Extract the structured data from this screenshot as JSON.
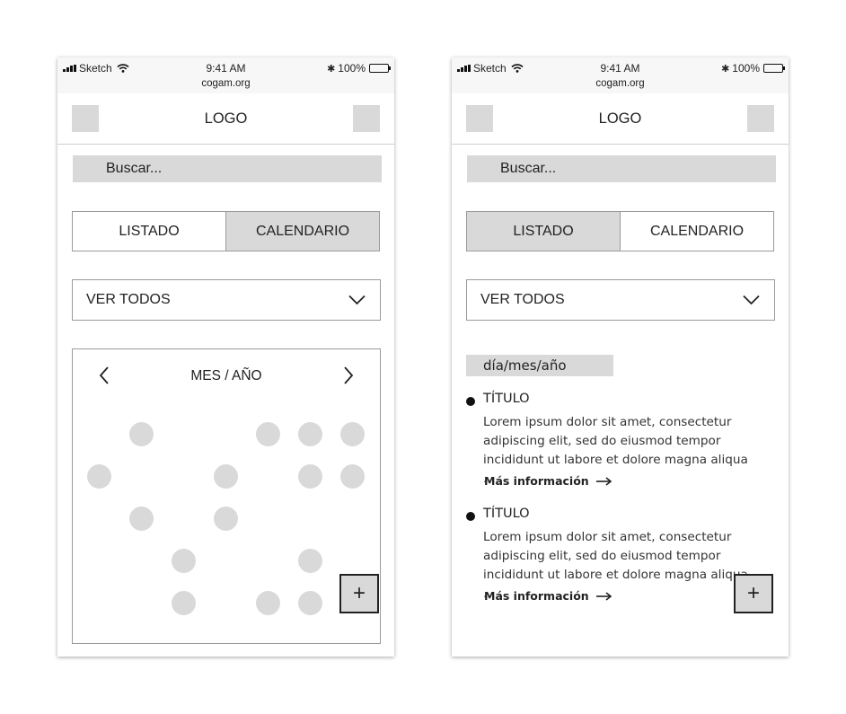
{
  "status_bar": {
    "carrier": "Sketch",
    "time": "9:41 AM",
    "battery": "100%",
    "url": "cogam.org"
  },
  "header": {
    "logo": "LOGO",
    "left_icon": "menu-placeholder",
    "right_icon": "action-placeholder"
  },
  "search": {
    "placeholder": "Buscar..."
  },
  "view_toggle": {
    "list_label": "LISTADO",
    "calendar_label": "CALENDARIO"
  },
  "filter": {
    "selected": "VER TODOS"
  },
  "calendar_view": {
    "active_tab": "calendar",
    "title": "MES / AÑO",
    "prev_icon": "chevron-left",
    "next_icon": "chevron-right",
    "fab_label": "+"
  },
  "list_view": {
    "active_tab": "list",
    "date_label": "día/mes/año",
    "events": [
      {
        "title": "TÍTULO",
        "body": "Lorem ipsum dolor sit amet, consectetur adipiscing elit, sed do eiusmod tempor incididunt ut labore et dolore magna aliqua ...",
        "more": "Más información"
      },
      {
        "title": "TÍTULO",
        "body": "Lorem ipsum dolor sit amet, consectetur adipiscing elit, sed do eiusmod tempor incididunt ut labore et dolore magna aliqua ...",
        "more": "Más información"
      }
    ],
    "fab_label": "+"
  },
  "colors": {
    "placeholder_gray": "#d9d9d9",
    "border_gray": "#9a9a9a",
    "text": "#222222"
  }
}
